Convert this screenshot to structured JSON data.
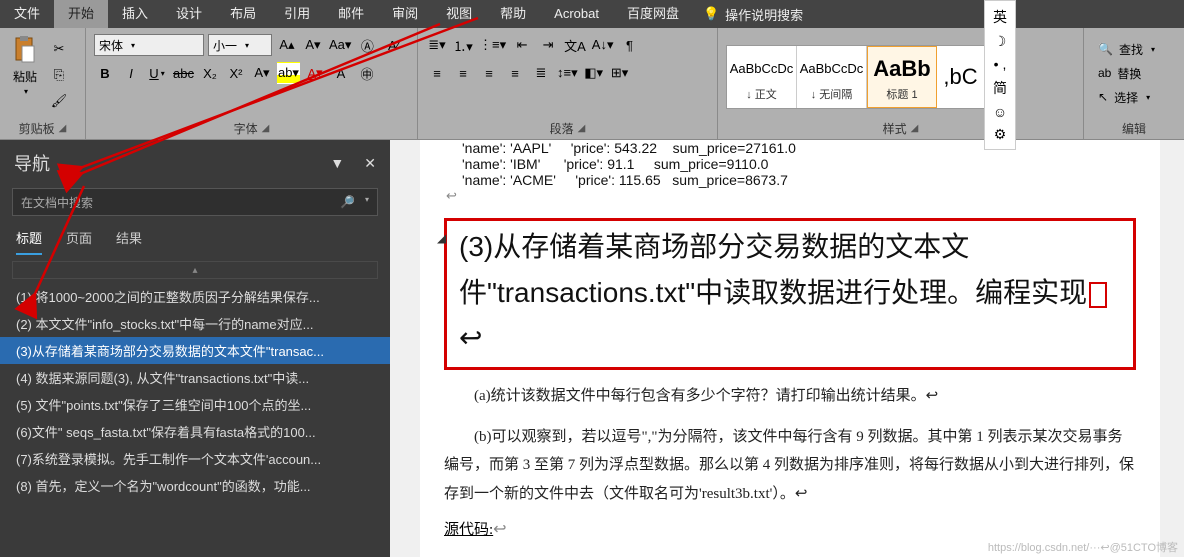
{
  "menu": {
    "tabs": [
      "文件",
      "开始",
      "插入",
      "设计",
      "布局",
      "引用",
      "邮件",
      "审阅",
      "视图",
      "帮助",
      "Acrobat",
      "百度网盘"
    ],
    "active": "开始",
    "search": "操作说明搜索"
  },
  "ribbon": {
    "clipboard": {
      "label": "剪贴板",
      "paste": "粘贴"
    },
    "font": {
      "label": "字体",
      "name": "宋体",
      "size": "小一"
    },
    "para": {
      "label": "段落"
    },
    "styles": {
      "label": "样式",
      "items": [
        {
          "prev": "AaBbCcDc",
          "name": "↓ 正文"
        },
        {
          "prev": "AaBbCcDc",
          "name": "↓ 无间隔"
        },
        {
          "prev": "AaBb",
          "name": "标题 1",
          "big": true,
          "sel": true
        },
        {
          "prev": ",bC",
          "name": ""
        }
      ]
    },
    "edit": {
      "label": "编辑",
      "find": "查找",
      "replace": "替换",
      "select": "选择"
    }
  },
  "nav": {
    "title": "导航",
    "search_ph": "在文档中搜索",
    "tabs": [
      "标题",
      "页面",
      "结果"
    ],
    "active": "标题",
    "items": [
      "(1) 将1000~2000之间的正整数质因子分解结果保存...",
      "(2) 本文文件\"info_stocks.txt\"中每一行的name对应...",
      "(3)从存储着某商场部分交易数据的文本文件\"transac...",
      "(4) 数据来源同题(3), 从文件\"transactions.txt\"中读...",
      "(5) 文件\"points.txt\"保存了三维空间中100个点的坐...",
      "(6)文件\" seqs_fasta.txt\"保存着具有fasta格式的100...",
      "(7)系统登录模拟。先手工制作一个文本文件'accoun...",
      "(8) 首先，定义一个名为\"wordcount\"的函数，功能..."
    ],
    "sel": 2
  },
  "doc": {
    "code": [
      "'name': 'AAPL'     'price': 543.22    sum_price=27161.0",
      "'name': 'IBM'      'price': 91.1     sum_price=9110.0",
      "'name': 'ACME'     'price': 115.65   sum_price=8673.7"
    ],
    "heading": "(3)从存储着某商场部分交易数据的文本文件\"transactions.txt\"中读取数据进行处理。编程实现",
    "pa": "(a)统计该数据文件中每行包含有多少个字符？请打印输出统计结果。↩",
    "pb": "(b)可以观察到，若以逗号\",\"为分隔符，该文件中每行含有 9 列数据。其中第 1 列表示某次交易事务编号，而第 3 至第 7 列为浮点型数据。那么以第 4 列数据为排序准则，将每行数据从小到大进行排列，保存到一个新的文件中去（文件取名可为'result3b.txt'）。↩",
    "src": "源代码:",
    "watermark": "https://blog.csdn.net/···↩@51CTO博客"
  },
  "ime": {
    "items": [
      "英",
      "☽",
      "• ,",
      "简",
      "☺",
      "⚙"
    ]
  }
}
